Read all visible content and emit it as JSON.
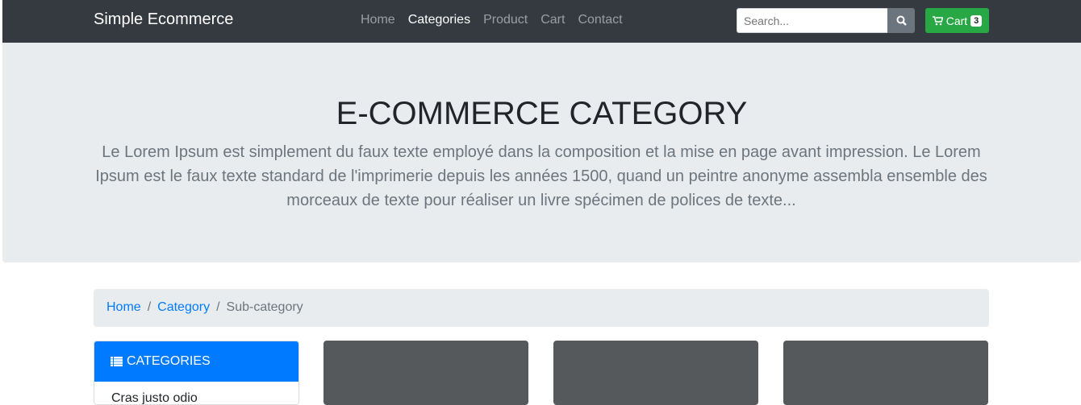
{
  "navbar": {
    "brand": "Simple Ecommerce",
    "links": [
      "Home",
      "Categories",
      "Product",
      "Cart",
      "Contact"
    ],
    "active": "Categories",
    "search_placeholder": "Search...",
    "cart_label": "Cart",
    "cart_count": "3"
  },
  "hero": {
    "title": "E-COMMERCE CATEGORY",
    "text": "Le Lorem Ipsum est simplement du faux texte employé dans la composition et la mise en page avant impression. Le Lorem Ipsum est le faux texte standard de l'imprimerie depuis les années 1500, quand un peintre anonyme assembla ensemble des morceaux de texte pour réaliser un livre spécimen de polices de texte..."
  },
  "breadcrumb": [
    "Home",
    "Category",
    "Sub-category"
  ],
  "sidebar": {
    "title": "CATEGORIES",
    "items": [
      "Cras justo odio"
    ]
  }
}
